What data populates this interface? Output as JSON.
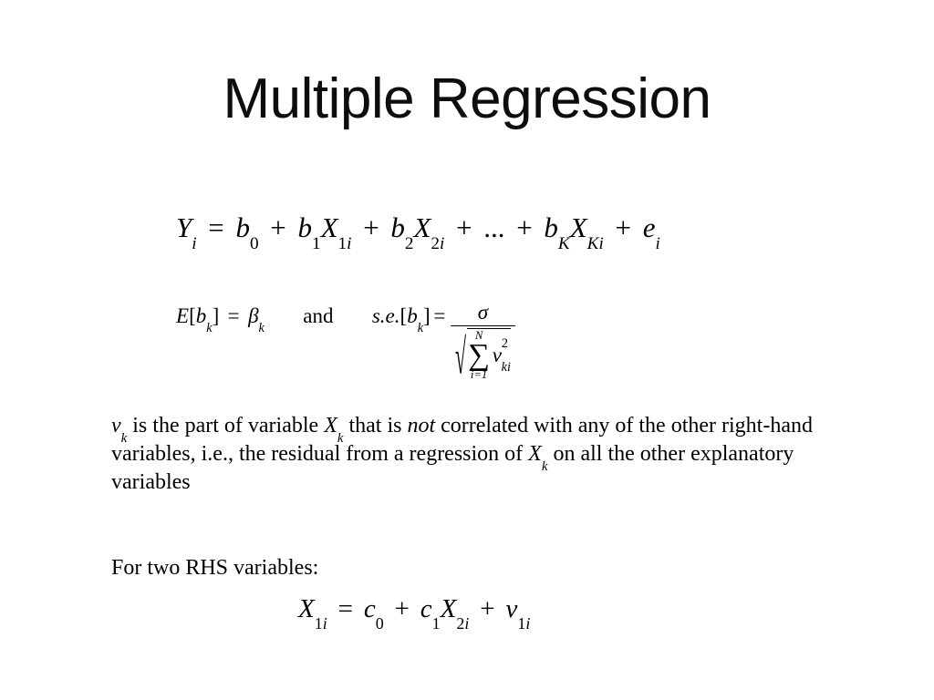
{
  "slide": {
    "title": "Multiple Regression",
    "background_color": "#ffffff",
    "text_color": "#000000"
  },
  "equations": {
    "main": {
      "plain": "Y_i = b_0 + b_1 X_1i + b_2 X_2i + ... + b_K X_Ki + e_i",
      "lhs_var": "Y",
      "lhs_sub": "i",
      "eq_sign": "=",
      "terms": [
        {
          "coef": "b",
          "coef_sub": "0"
        },
        {
          "coef": "b",
          "coef_sub": "1",
          "var": "X",
          "var_sub_num": "1",
          "var_sub_idx": "i"
        },
        {
          "coef": "b",
          "coef_sub": "2",
          "var": "X",
          "var_sub_num": "2",
          "var_sub_idx": "i"
        },
        {
          "ellipsis": "..."
        },
        {
          "coef": "b",
          "coef_sub": "K",
          "var": "X",
          "var_sub_num": "K",
          "var_sub_idx": "i"
        },
        {
          "coef": "e",
          "coef_sub": "i"
        }
      ],
      "plus": "+"
    },
    "expectation": {
      "plain": "E[b_k] = β_k",
      "func": "E",
      "open_bracket": "[",
      "arg_var": "b",
      "arg_sub": "k",
      "close_bracket": "]",
      "eq_sign": "=",
      "rhs_var": "β",
      "rhs_sub": "k"
    },
    "conjunction": "and",
    "standard_error": {
      "plain": "s.e.[b_k] = σ / sqrt( sum_{i=1}^{N} v_ki^2 )",
      "func": "s.e.",
      "open_bracket": "[",
      "arg_var": "b",
      "arg_sub": "k",
      "close_bracket": "]",
      "eq_sign": "=",
      "numerator": "σ",
      "radical_sign": "√",
      "sum_symbol": "∑",
      "sum_upper": "N",
      "sum_lower": "i=1",
      "sum_body_var": "v",
      "sum_body_sub": "ki",
      "sum_body_sup": "2"
    },
    "last": {
      "plain": "X_1i = c_0 + c_1 X_2i + v_1i",
      "lhs_var": "X",
      "lhs_sub_num": "1",
      "lhs_sub_idx": "i",
      "eq_sign": "=",
      "plus": "+",
      "terms": [
        {
          "coef": "c",
          "coef_sub": "0"
        },
        {
          "coef": "c",
          "coef_sub": "1",
          "var": "X",
          "var_sub_num": "2",
          "var_sub_idx": "i"
        },
        {
          "coef": "v",
          "coef_sub_num": "1",
          "coef_sub_idx": "i"
        }
      ]
    }
  },
  "body": {
    "full_text": "v_k is the part of variable X_k that is not correlated with any of the other right-hand variables, i.e., the residual from a regression of X_k on all the other explanatory variables",
    "seg_1_var": "v",
    "seg_1_sub": "k",
    "seg_2": " is the part of variable ",
    "seg_3_var": "X",
    "seg_3_sub": "k",
    "seg_4": " that is ",
    "seg_5_italic": "not",
    "seg_6": " correlated with any of the other right-hand variables, i.e., the residual from a regression of ",
    "seg_7_var": "X",
    "seg_7_sub": "k",
    "seg_8": " on all the other explanatory variables"
  },
  "lead": {
    "text": "For two RHS variables:"
  }
}
